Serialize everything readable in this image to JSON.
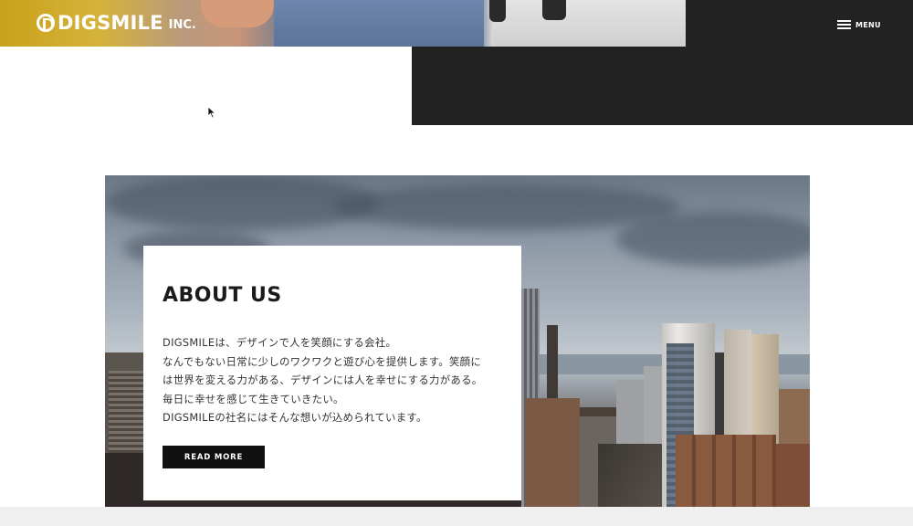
{
  "header": {
    "logo_text": "DIGSMILE",
    "logo_suffix": "INC.",
    "menu_label": "MENU"
  },
  "about": {
    "title": "ABOUT US",
    "lines": [
      "DIGSMILEは、デザインで人を笑顔にする会社。",
      "なんでもない日常に少しのワクワクと遊び心を提供します。笑顔に",
      "は世界を変える力がある、デザインには人を幸せにする力がある。",
      "毎日に幸せを感じて生きていきたい。",
      "DIGSMILEの社名にはそんな想いが込められています。"
    ],
    "button_label": "READ MORE"
  },
  "colors": {
    "dark_panel": "#222222",
    "button_bg": "#111111",
    "text": "#333333"
  },
  "icons": [
    "logo-mark-icon",
    "hamburger-icon",
    "mouse-cursor-icon"
  ]
}
